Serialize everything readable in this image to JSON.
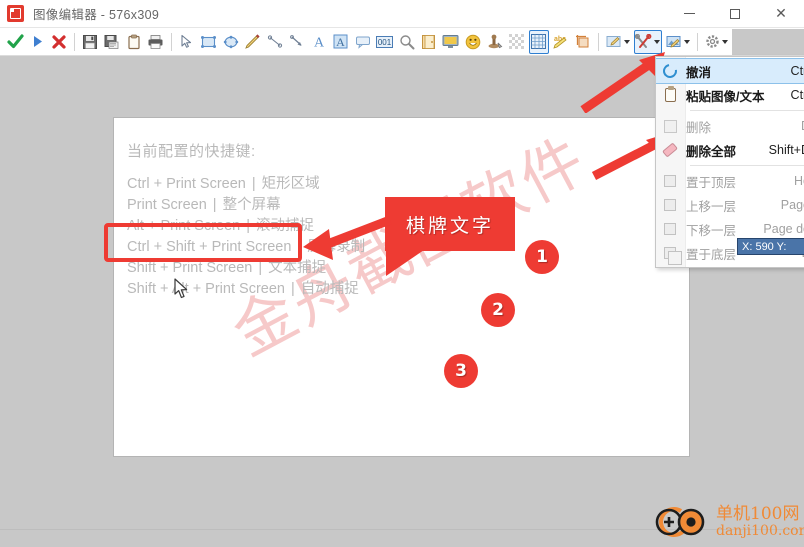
{
  "window": {
    "title": "图像编辑器 - 576x309",
    "app_icon": "image-editor-icon",
    "controls": {
      "minimize": "–",
      "maximize": "□",
      "close": "✕"
    }
  },
  "toolbar": {
    "items": [
      {
        "name": "confirm-button",
        "icon": "green-check-icon",
        "glyph": "✔",
        "color": "#21a34a"
      },
      {
        "name": "run-button",
        "icon": "blue-play-icon",
        "glyph": "▶",
        "color": "#3f7fd0"
      },
      {
        "name": "cancel-button",
        "icon": "red-cross-icon",
        "glyph": "✖",
        "color": "#d32f2f"
      },
      {
        "name": "save-button",
        "icon": "floppy-save-icon",
        "glyph": "💾",
        "color": "#555555"
      },
      {
        "name": "save-as-button",
        "icon": "floppy-save-as-icon",
        "glyph": "🖫",
        "color": "#555555"
      },
      {
        "name": "clipboard-button",
        "icon": "clipboard-icon",
        "glyph": "📋",
        "color": "#8a6e4f"
      },
      {
        "name": "print-button",
        "icon": "printer-icon",
        "glyph": "🖨",
        "color": "#4a4a4a"
      },
      {
        "name": "select-tool",
        "icon": "cursor-arrow-icon",
        "glyph": "➤",
        "color": "#6f7f94"
      },
      {
        "name": "rectangle-tool",
        "icon": "rectangle-icon",
        "glyph": "▭",
        "color": "#5b8fc9"
      },
      {
        "name": "ellipse-tool",
        "icon": "ellipse-icon",
        "glyph": "◯",
        "color": "#5b8fc9"
      },
      {
        "name": "pencil-tool",
        "icon": "pencil-icon",
        "glyph": "✏",
        "color": "#d9a23a"
      },
      {
        "name": "line-tool",
        "icon": "line-icon",
        "glyph": "╲",
        "color": "#6f7f94"
      },
      {
        "name": "arrow-tool",
        "icon": "arrow-icon",
        "glyph": "↘",
        "color": "#6f7f94"
      },
      {
        "name": "text-tool",
        "icon": "letter-a-icon",
        "glyph": "A",
        "color": "#5b8fc9"
      },
      {
        "name": "text-box-tool",
        "icon": "letter-a-box-icon",
        "glyph": "A",
        "color": "#5b8fc9"
      },
      {
        "name": "callout-tool",
        "icon": "speech-bubble-icon",
        "glyph": "🗨",
        "color": "#8fb4d8"
      },
      {
        "name": "number-tool",
        "icon": "number-001-icon",
        "glyph": "001",
        "color": "#4a7cb5"
      },
      {
        "name": "magnifier-tool",
        "icon": "magnifier-icon",
        "glyph": "🔍",
        "color": "#8a8a8a"
      },
      {
        "name": "image-tool",
        "icon": "image-insert-icon",
        "glyph": "🖼",
        "color": "#d8a14a"
      },
      {
        "name": "screen-tool",
        "icon": "monitor-icon",
        "glyph": "🖥",
        "color": "#c8a040"
      },
      {
        "name": "emoji-tool",
        "icon": "smiley-icon",
        "glyph": "😀",
        "color": "#e2b33a"
      },
      {
        "name": "stamp-tool",
        "icon": "stamp-icon",
        "glyph": "🖋",
        "color": "#8a6e4f"
      },
      {
        "name": "mosaic-tool",
        "icon": "mosaic-icon",
        "glyph": "▒",
        "color": "#c0c0c0"
      },
      {
        "name": "grid-tool",
        "icon": "grid-icon",
        "glyph": "▦",
        "color": "#4a7cb5",
        "active": true
      },
      {
        "name": "watermark-tool",
        "icon": "abc-pencil-icon",
        "glyph": "abc",
        "color": "#d9b33a"
      },
      {
        "name": "crop-tool",
        "icon": "crop-icon",
        "glyph": "⌗",
        "color": "#d98a3a"
      }
    ],
    "dropdowns": [
      {
        "name": "edit-dropdown",
        "icon": "edit-pencil-icon",
        "glyph": "✎",
        "color": "#7a9cc0"
      },
      {
        "name": "tools-dropdown",
        "icon": "wrench-screwdriver-icon",
        "glyph": "⚒",
        "color": "#cc3b33",
        "active": true
      },
      {
        "name": "image-dropdown",
        "icon": "image-edit-icon",
        "glyph": "🖼",
        "color": "#5b8fc9"
      },
      {
        "name": "settings-dropdown",
        "icon": "gear-icon",
        "glyph": "⚙",
        "color": "#888888"
      }
    ]
  },
  "canvas": {
    "heading": "当前配置的快捷键:",
    "watermark_diagonal": "金舟截图软件",
    "shortcuts": [
      {
        "keys": "Ctrl + Print Screen",
        "sep": "|",
        "action": "矩形区域"
      },
      {
        "keys": "Print Screen",
        "sep": "|",
        "action": "整个屏幕"
      },
      {
        "keys": "Alt + Print Screen",
        "sep": "|",
        "action": "滚动捕捉"
      },
      {
        "keys": "Ctrl + Shift + Print Screen",
        "sep": "|",
        "action": "屏幕录制"
      },
      {
        "keys": "Shift + Print Screen",
        "sep": "|",
        "action": "文本捕捉"
      },
      {
        "keys": "Shift + Alt + Print Screen",
        "sep": "|",
        "action": "自动捕捉"
      }
    ],
    "annotations": {
      "callout_text": "棋牌文字",
      "badges": [
        "1",
        "2",
        "3"
      ],
      "accent_color": "#ee3b33"
    }
  },
  "menu": {
    "items": [
      {
        "label": "撤消",
        "shortcut": "Ctrl",
        "icon": "undo-icon",
        "disabled": false,
        "highlight": true
      },
      {
        "label": "粘贴图像/文本",
        "shortcut": "Ctrl",
        "icon": "clipboard-paste-icon",
        "disabled": false,
        "highlight": false
      },
      {
        "separator": true
      },
      {
        "label": "删除",
        "shortcut": "D",
        "icon": "delete-icon",
        "disabled": true,
        "highlight": false
      },
      {
        "label": "删除全部",
        "shortcut": "Shift+D",
        "icon": "eraser-icon",
        "disabled": false,
        "highlight": false
      },
      {
        "separator": true
      },
      {
        "label": "置于顶层",
        "shortcut": "Ho",
        "icon": "bring-to-front-icon",
        "disabled": true,
        "highlight": false
      },
      {
        "label": "上移一层",
        "shortcut": "Page",
        "icon": "bring-forward-icon",
        "disabled": true,
        "highlight": false
      },
      {
        "label": "下移一层",
        "shortcut": "Page do",
        "icon": "send-backward-icon",
        "disabled": true,
        "highlight": false
      },
      {
        "label": "置于底层",
        "shortcut": "E",
        "icon": "send-to-back-icon",
        "disabled": true,
        "highlight": false
      }
    ]
  },
  "coordinate_tooltip": {
    "text": "X: 590 Y:"
  },
  "watermark_logo": {
    "cn": "单机100网",
    "en": "danji100.com",
    "color": "#f08a36"
  },
  "statusbar": {
    "text": ""
  }
}
